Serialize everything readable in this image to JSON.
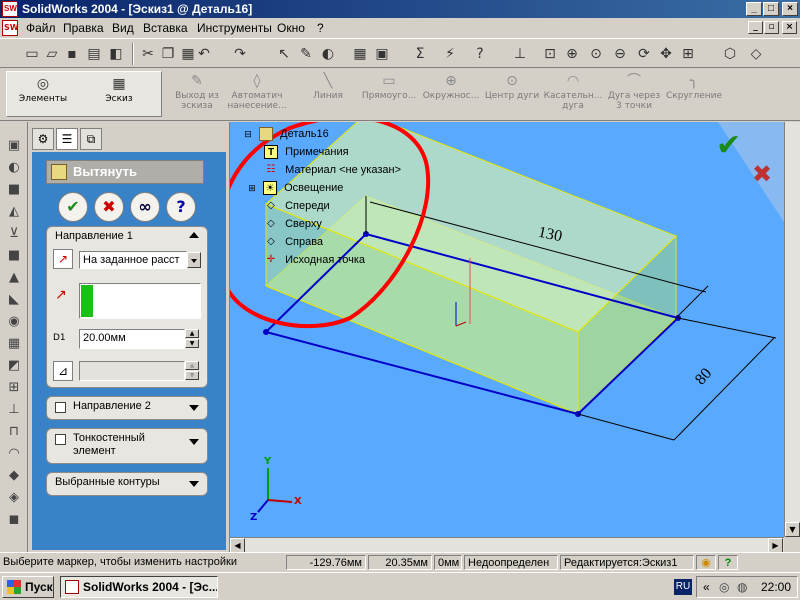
{
  "window": {
    "title": "SolidWorks 2004 - [Эскиз1 @ Деталь16]"
  },
  "menu": {
    "items": [
      "Файл",
      "Правка",
      "Вид",
      "Вставка",
      "Инструменты",
      "Окно",
      "?"
    ]
  },
  "command_manager": {
    "left": [
      {
        "label": "Элементы",
        "icon": "features-icon"
      },
      {
        "label": "Эскиз",
        "icon": "sketch-icon"
      }
    ],
    "right": [
      {
        "label": "Выход из эскиза",
        "icon": "exit-sketch-icon"
      },
      {
        "label": "Автоматич нанесение...",
        "icon": "smart-dimension-icon"
      },
      {
        "label": "Линия",
        "icon": "line-icon"
      },
      {
        "label": "Прямоуго...",
        "icon": "rectangle-icon"
      },
      {
        "label": "Окружнос...",
        "icon": "circle-icon"
      },
      {
        "label": "Центр дуги",
        "icon": "center-arc-icon"
      },
      {
        "label": "Касательн... дуга",
        "icon": "tangent-arc-icon"
      },
      {
        "label": "Дуга через 3 точки",
        "icon": "three-point-arc-icon"
      },
      {
        "label": "Скругление",
        "icon": "fillet-icon"
      }
    ]
  },
  "property_manager": {
    "title": "Вытянуть",
    "direction1": {
      "title": "Направление 1",
      "end_condition": "На заданное расст",
      "depth_value": "20.00мм",
      "depth_label": "D1"
    },
    "direction2": {
      "title": "Направление 2"
    },
    "thin_feature": {
      "title": "Тонкостенный элемент"
    },
    "selected_contours": {
      "title": "Выбранные контуры"
    }
  },
  "feature_tree": {
    "root": "Деталь16",
    "items": [
      {
        "label": "Примечания",
        "icon": "annotations-icon"
      },
      {
        "label": "Материал <не указан>",
        "icon": "material-icon"
      },
      {
        "label": "Освещение",
        "icon": "lighting-icon"
      },
      {
        "label": "Спереди",
        "icon": "plane-icon"
      },
      {
        "label": "Сверху",
        "icon": "plane-icon"
      },
      {
        "label": "Справа",
        "icon": "plane-icon"
      },
      {
        "label": "Исходная точка",
        "icon": "origin-icon"
      }
    ]
  },
  "viewport": {
    "dimension_length": "130",
    "dimension_width": "80",
    "triad": {
      "x": "X",
      "y": "Y",
      "z": "Z"
    },
    "colors": {
      "background": "#59a9ff",
      "preview_fill": "#b8e6a8",
      "sketch": "#0000c8",
      "highlight": "#ff0000"
    }
  },
  "status": {
    "message": "Выберите маркер, чтобы изменить настройки",
    "x": "-129.76мм",
    "y": "20.35мм",
    "z": "0мм",
    "sketch_state": "Недоопределен",
    "editing": "Редактируется:Эскиз1"
  },
  "taskbar": {
    "start": "Пуск",
    "task": "SolidWorks 2004 - [Эс...",
    "lang": "RU",
    "time": "22:00"
  }
}
